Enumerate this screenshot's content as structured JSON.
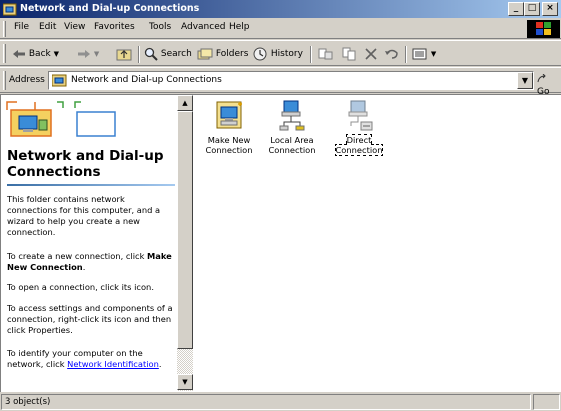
{
  "window": {
    "title": "Network and Dial-up Connections",
    "buttons": {
      "minimize": "_",
      "maximize": "□",
      "close": "×"
    }
  },
  "menu": {
    "items": [
      "File",
      "Edit",
      "View",
      "Favorites",
      "Tools",
      "Advanced",
      "Help"
    ]
  },
  "toolbar": {
    "back": "Back",
    "forward_icon": "forward-arrow-icon",
    "search": "Search",
    "folders": "Folders",
    "history": "History"
  },
  "address": {
    "label": "Address",
    "value": "Network and Dial-up Connections",
    "go": "Go"
  },
  "left_pane": {
    "title": "Network and Dial-up Connections",
    "p1": "This folder contains network connections for this computer, and a wizard to help you create a new connection.",
    "p2_prefix": "To create a new connection, click ",
    "p2_bold": "Make New Connection",
    "p2_suffix": ".",
    "p3": "To open a connection, click its icon.",
    "p4": "To access settings and components of a connection, right-click its icon and then click Properties.",
    "p5_prefix": "To identify your computer on the network, click ",
    "p5_link": "Network Identification",
    "p5_suffix": "."
  },
  "items": [
    {
      "line1": "Make New",
      "line2": "Connection",
      "icon": "make-new-connection-icon"
    },
    {
      "line1": "Local Area",
      "line2": "Connection",
      "icon": "local-area-connection-icon"
    },
    {
      "line1": "Direct",
      "line2": "Connection",
      "icon": "direct-connection-icon"
    }
  ],
  "status": {
    "text": "3 object(s)"
  },
  "colors": {
    "titlebar_start": "#0a246a",
    "titlebar_end": "#a6caf0",
    "link": "#0000ff",
    "face": "#d4d0c8"
  }
}
